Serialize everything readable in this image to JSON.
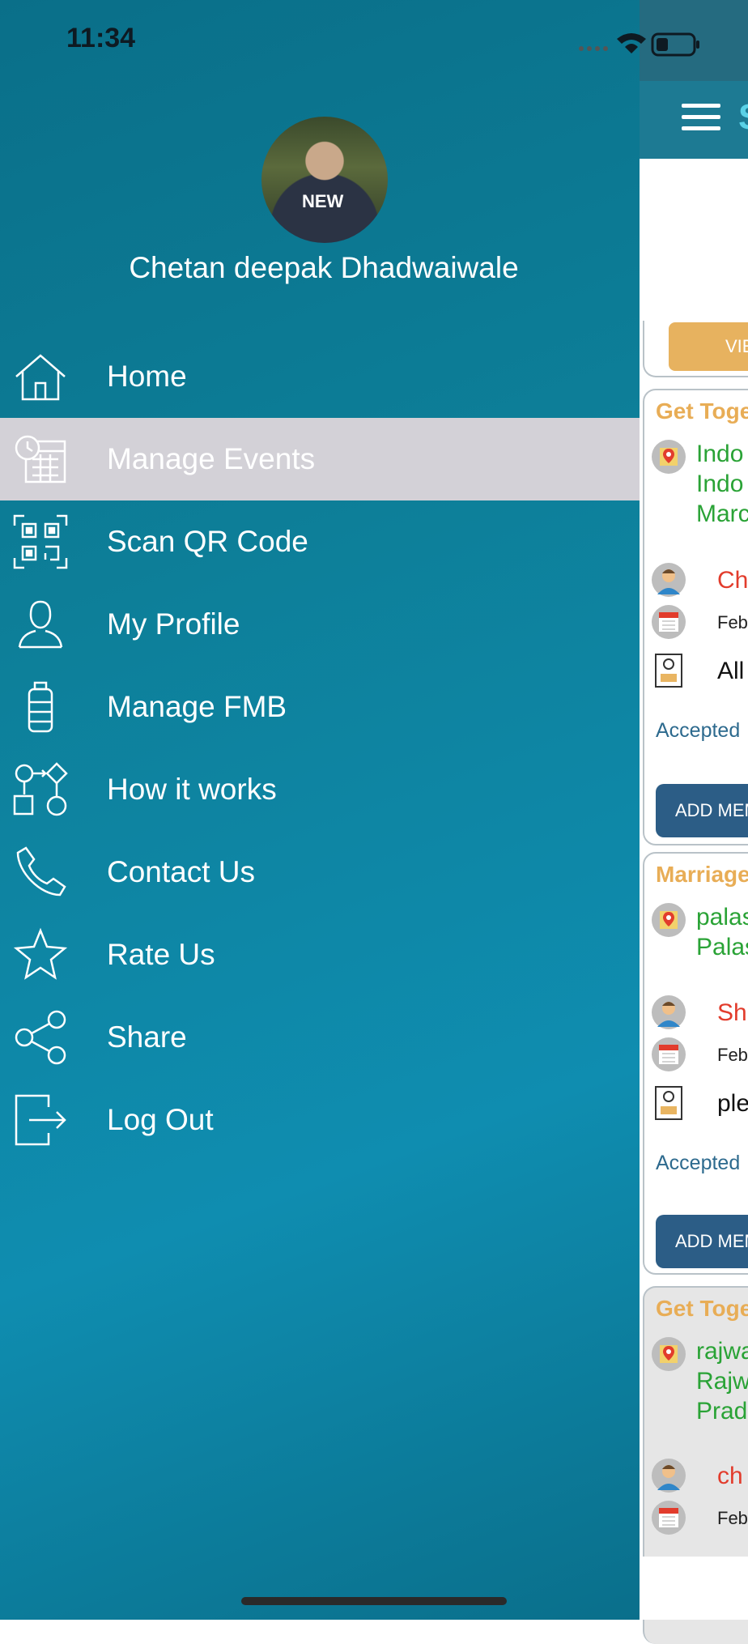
{
  "status_bar": {
    "time": "11:34"
  },
  "profile": {
    "name": "Chetan deepak Dhadwaiwale",
    "shirt_text": "NEW"
  },
  "menu": {
    "items": [
      {
        "label": "Home",
        "icon": "home-icon"
      },
      {
        "label": "Manage Events",
        "icon": "calendar-clock-icon",
        "active": true
      },
      {
        "label": "Scan QR Code",
        "icon": "qr-code-icon"
      },
      {
        "label": "My Profile",
        "icon": "user-icon"
      },
      {
        "label": "Manage FMB",
        "icon": "container-icon"
      },
      {
        "label": "How it works",
        "icon": "flowchart-icon"
      },
      {
        "label": "Contact Us",
        "icon": "phone-icon"
      },
      {
        "label": "Rate Us",
        "icon": "star-icon"
      },
      {
        "label": "Share",
        "icon": "share-icon"
      },
      {
        "label": "Log Out",
        "icon": "logout-icon"
      }
    ]
  },
  "background_screen": {
    "header_letter": "S",
    "top_button": "VIE",
    "cards": [
      {
        "type": "Get Toge",
        "address": [
          "Indo",
          "Indo",
          "Marc"
        ],
        "host": "Ch",
        "date": "Feb",
        "note": "All",
        "status": "Accepted",
        "button": "ADD MEM"
      },
      {
        "type": "Marriage",
        "address": [
          "palas",
          "Palas"
        ],
        "host": "Sh",
        "date": "Feb",
        "note": "ple",
        "status": "Accepted",
        "button": "ADD MEM"
      },
      {
        "type": "Get Toge",
        "address": [
          "rajwa",
          "Rajw",
          "Prad"
        ],
        "host": "ch",
        "date": "Feb"
      }
    ]
  },
  "colors": {
    "drawer_start": "#0a6f89",
    "drawer_end": "#0f8db0",
    "active_item_bg": "#d3d1d7",
    "event_type": "#e8ad56",
    "address": "#2aa336",
    "host": "#e23c2c",
    "button": "#2c5d86"
  }
}
